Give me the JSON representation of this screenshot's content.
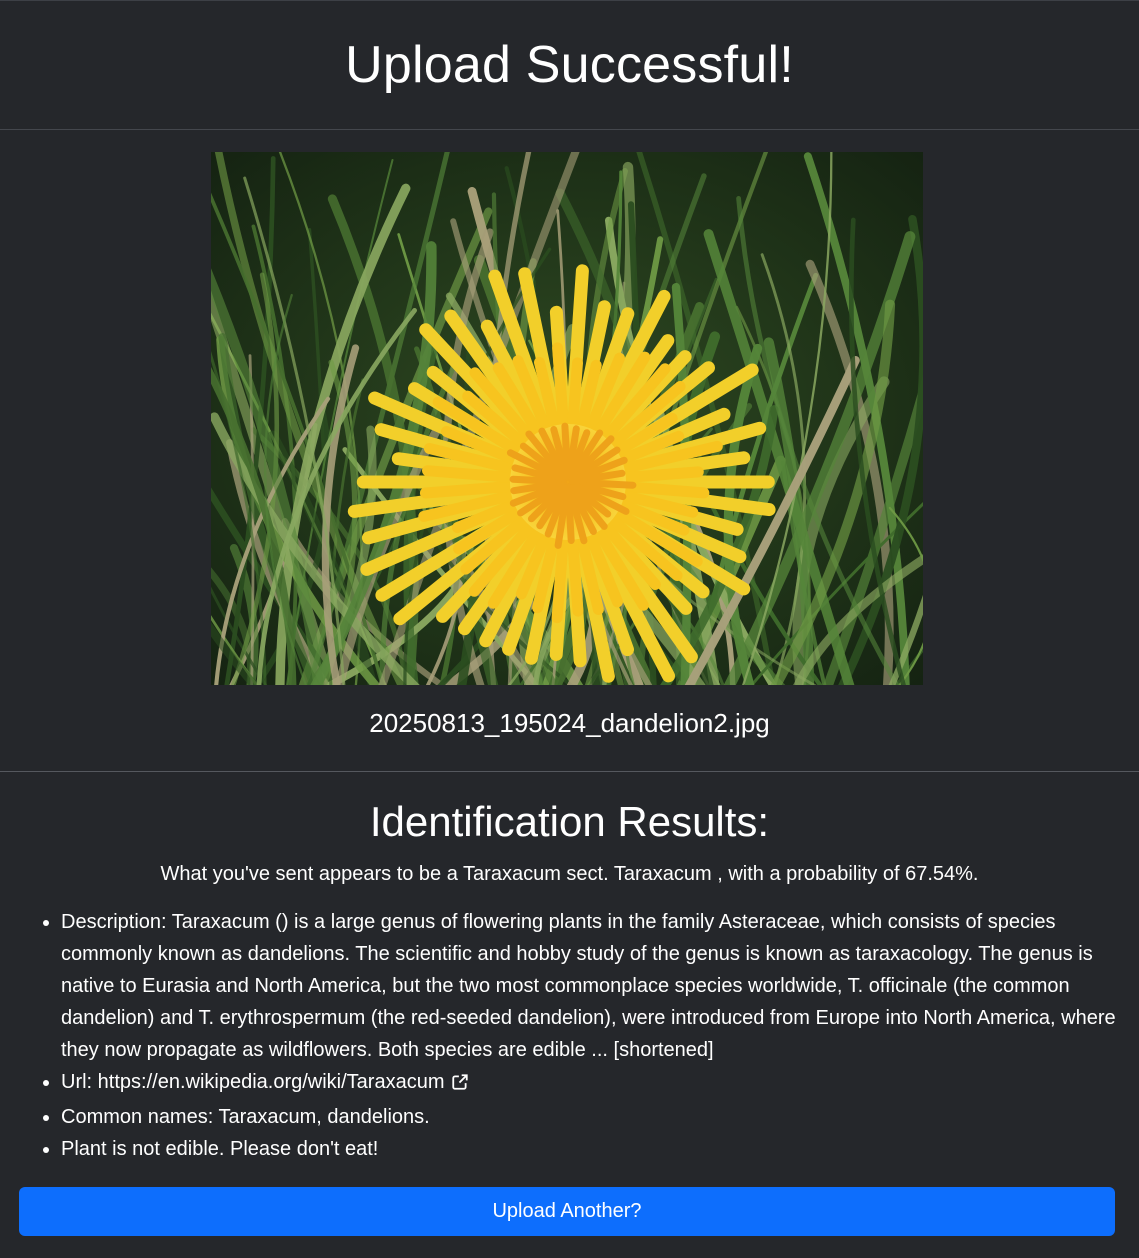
{
  "header": {
    "title": "Upload Successful!"
  },
  "upload": {
    "filename": "20250813_195024_dandelion2.jpg"
  },
  "results": {
    "heading": "Identification Results:",
    "summary": "What you've sent appears to be a Taraxacum sect. Taraxacum , with a probability of 67.54%.",
    "description": "Description: Taraxacum () is a large genus of flowering plants in the family Asteraceae, which consists of species commonly known as dandelions. The scientific and hobby study of the genus is known as taraxacology. The genus is native to Eurasia and North America, but the two most commonplace species worldwide, T. officinale (the common dandelion) and T. erythrospermum (the red-seeded dandelion), were introduced from Europe into North America, where they now propagate as wildflowers. Both species are edible ... [shortened]",
    "url_label": "Url: ",
    "url": "https://en.wikipedia.org/wiki/Taraxacum",
    "common_names": "Common names: Taraxacum, dandelions.",
    "edibility": "Plant is not edible. Please don't eat!"
  },
  "actions": {
    "upload_another_label": "Upload Another?"
  },
  "colors": {
    "background": "#25272b",
    "divider": "#44474d",
    "button": "#0d6efd",
    "text": "#ffffff",
    "flower": "#f5c81e",
    "grass": "#3f6b2c"
  },
  "icons": {
    "url_icon": "external-link-icon"
  }
}
